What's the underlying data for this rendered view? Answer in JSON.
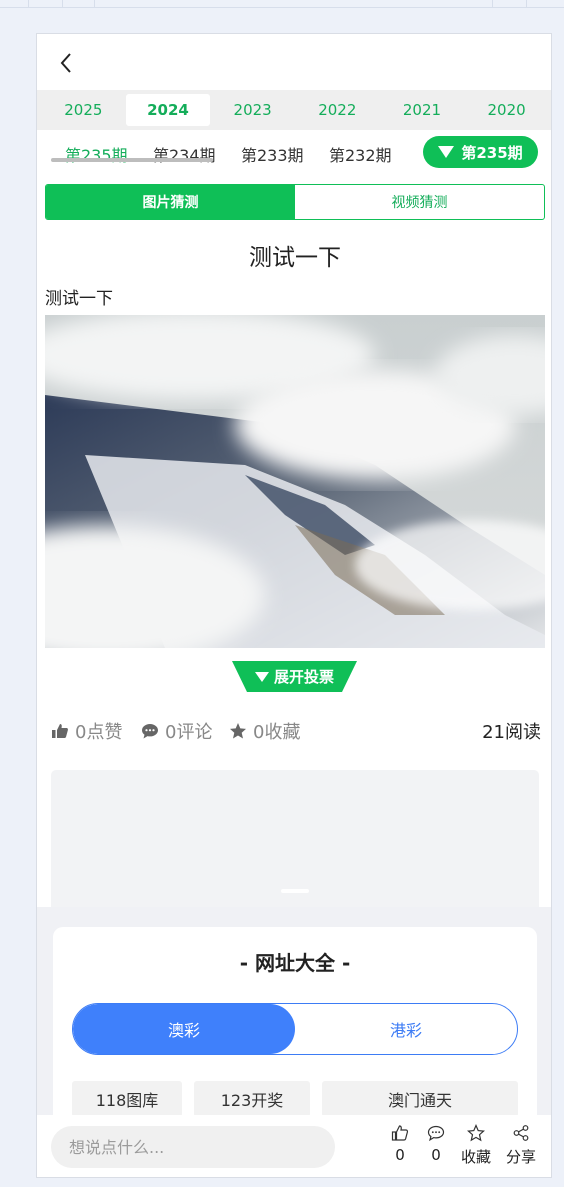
{
  "nav": {
    "back_icon": "chevron-left-icon"
  },
  "years": [
    "2025",
    "2024",
    "2023",
    "2022",
    "2021",
    "2020"
  ],
  "active_year": "2024",
  "issues": [
    "第235期",
    "第234期",
    "第233期",
    "第232期"
  ],
  "active_issue": "第235期",
  "issue_selector": {
    "label": "第235期",
    "icon": "triangle-down-icon"
  },
  "mode_tabs": [
    {
      "label": "图片猜测",
      "active": true
    },
    {
      "label": "视频猜测",
      "active": false
    }
  ],
  "post": {
    "title": "测试一下",
    "subtitle": "测试一下"
  },
  "vote_button": {
    "label": "展开投票",
    "icon": "triangle-down-icon"
  },
  "stats": {
    "likes": "0点赞",
    "comments": "0评论",
    "favorites": "0收藏",
    "reads": "21阅读"
  },
  "sites": {
    "title": "- 网址大全 -",
    "regions": [
      {
        "label": "澳彩",
        "active": true
      },
      {
        "label": "港彩",
        "active": false
      }
    ],
    "links": [
      "118图库",
      "123开奖",
      "澳门通天"
    ]
  },
  "bottom_bar": {
    "placeholder": "想说点什么...",
    "like_count": "0",
    "comment_count": "0",
    "favorite_label": "收藏",
    "share_label": "分享"
  },
  "colors": {
    "green": "#0fbf57",
    "green_text": "#14ad5a",
    "blue": "#3f80fb",
    "page_bg": "#edf1f9"
  }
}
